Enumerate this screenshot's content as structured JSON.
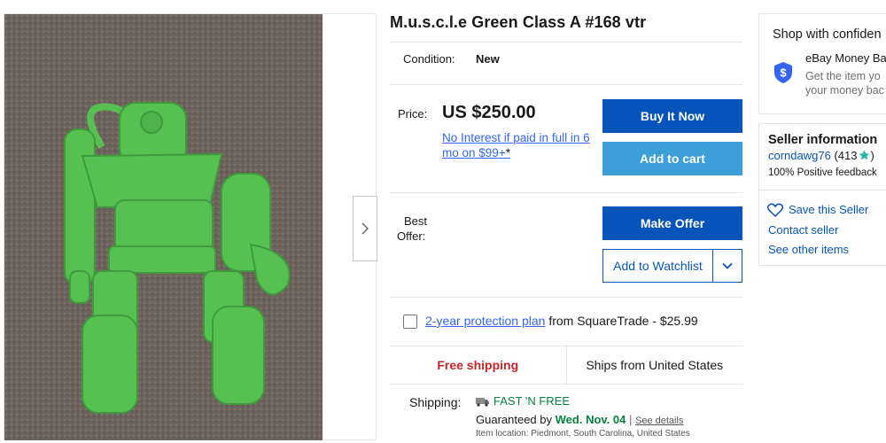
{
  "title": "M.u.s.c.l.e Green Class A #168 vtr",
  "condition": {
    "label": "Condition:",
    "value": "New"
  },
  "price": {
    "label": "Price:",
    "value": "US $250.00",
    "financing": "No Interest if paid in full in 6 mo on $99+",
    "financing_mark": "*"
  },
  "buttons": {
    "buy_now": "Buy It Now",
    "add_to_cart": "Add to cart",
    "make_offer": "Make Offer",
    "watchlist": "Add to Watchlist"
  },
  "best_offer": {
    "label_line1": "Best",
    "label_line2": "Offer:"
  },
  "protection": {
    "link": "2-year protection plan",
    "rest": "from SquareTrade - $25.99"
  },
  "shipping_summary": {
    "free": "Free shipping",
    "ships_from": "Ships from United States"
  },
  "shipping": {
    "label": "Shipping:",
    "badge": "FAST 'N FREE",
    "guaranteed_prefix": "Guaranteed by",
    "guaranteed_date": "Wed. Nov. 04",
    "separator": "|",
    "see_details": "See details",
    "location": "Item location: Piedmont, South Carolina, United States"
  },
  "shop_confidence": {
    "title": "Shop with confiden",
    "money_back_title": "eBay Money Ba",
    "money_back_line1": "Get the item yo",
    "money_back_line2": "your money bac"
  },
  "seller": {
    "title": "Seller information",
    "name": "corndawg76",
    "score": "(413",
    "score_close": ")",
    "feedback": "100% Positive feedback",
    "save": "Save this Seller",
    "contact": "Contact seller",
    "other": "See other items"
  },
  "colors": {
    "primary_button": "#0654ba",
    "cart_button": "#3d9fd8",
    "link": "#3665f3",
    "free_shipping": "#c62527",
    "fast_n_free": "#05823f"
  },
  "icons": [
    "chevron-right-icon",
    "chevron-down-icon",
    "truck-icon",
    "shield-dollar-icon",
    "star-icon",
    "heart-icon"
  ]
}
